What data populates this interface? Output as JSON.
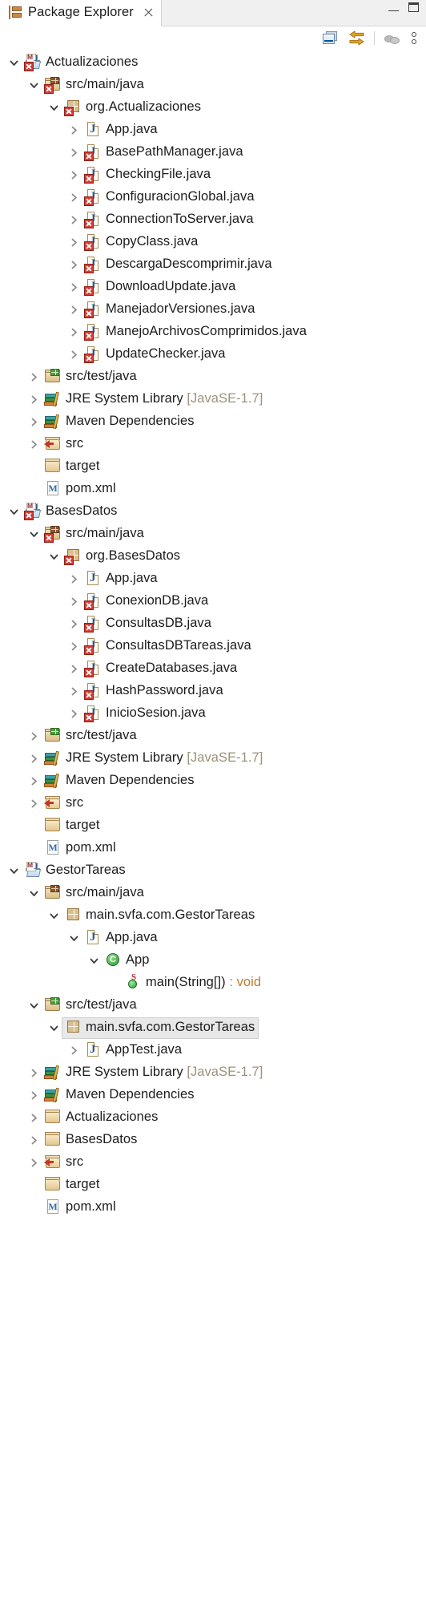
{
  "window": {
    "minimize_label": "Minimize",
    "maximize_label": "Maximize"
  },
  "tab": {
    "title": "Package Explorer",
    "icon": "package-explorer-icon",
    "close_icon": "close-icon"
  },
  "toolbar": {
    "items": [
      {
        "name": "collapse-all-button",
        "tooltip": "Collapse All"
      },
      {
        "name": "link-with-editor-button",
        "tooltip": "Link with Editor"
      },
      {
        "name": "view-menu-button",
        "tooltip": "View Menu"
      },
      {
        "name": "view-options-button",
        "tooltip": "View Menu"
      }
    ]
  },
  "colors": {
    "selection_bg": "#e8e8e8",
    "error_badge": "#d33b33",
    "dim_text": "#9b9379",
    "return_type": "#c07a2e",
    "text": "#1c1c1c"
  },
  "tree": {
    "rows": [
      {
        "indent": 0,
        "twisty": "expanded",
        "icon": "maven-java-project-icon",
        "error": true,
        "label": "Actualizaciones"
      },
      {
        "indent": 1,
        "twisty": "expanded",
        "icon": "source-folder-icon",
        "error": true,
        "label": "src/main/java"
      },
      {
        "indent": 2,
        "twisty": "expanded",
        "icon": "package-icon",
        "error": true,
        "label": "org.Actualizaciones"
      },
      {
        "indent": 3,
        "twisty": "collapsed",
        "icon": "java-file-icon",
        "error": false,
        "label": "App.java"
      },
      {
        "indent": 3,
        "twisty": "collapsed",
        "icon": "java-file-icon",
        "error": true,
        "label": "BasePathManager.java"
      },
      {
        "indent": 3,
        "twisty": "collapsed",
        "icon": "java-file-icon",
        "error": true,
        "label": "CheckingFile.java"
      },
      {
        "indent": 3,
        "twisty": "collapsed",
        "icon": "java-file-icon",
        "error": true,
        "label": "ConfiguracionGlobal.java"
      },
      {
        "indent": 3,
        "twisty": "collapsed",
        "icon": "java-file-icon",
        "error": true,
        "label": "ConnectionToServer.java"
      },
      {
        "indent": 3,
        "twisty": "collapsed",
        "icon": "java-file-icon",
        "error": true,
        "label": "CopyClass.java"
      },
      {
        "indent": 3,
        "twisty": "collapsed",
        "icon": "java-file-icon",
        "error": true,
        "label": "DescargaDescomprimir.java"
      },
      {
        "indent": 3,
        "twisty": "collapsed",
        "icon": "java-file-icon",
        "error": true,
        "label": "DownloadUpdate.java"
      },
      {
        "indent": 3,
        "twisty": "collapsed",
        "icon": "java-file-icon",
        "error": true,
        "label": "ManejadorVersiones.java"
      },
      {
        "indent": 3,
        "twisty": "collapsed",
        "icon": "java-file-icon",
        "error": true,
        "label": "ManejoArchivosComprimidos.java"
      },
      {
        "indent": 3,
        "twisty": "collapsed",
        "icon": "java-file-icon",
        "error": true,
        "label": "UpdateChecker.java"
      },
      {
        "indent": 1,
        "twisty": "collapsed",
        "icon": "test-source-folder-icon",
        "error": false,
        "label": "src/test/java"
      },
      {
        "indent": 1,
        "twisty": "collapsed",
        "icon": "library-icon",
        "error": false,
        "label": "JRE System Library ",
        "dim": "[JavaSE-1.7]"
      },
      {
        "indent": 1,
        "twisty": "collapsed",
        "icon": "library-icon",
        "error": false,
        "label": "Maven Dependencies"
      },
      {
        "indent": 1,
        "twisty": "collapsed",
        "icon": "linked-folder-icon",
        "error": false,
        "label": "src"
      },
      {
        "indent": 1,
        "twisty": "none",
        "icon": "folder-icon",
        "error": false,
        "label": "target"
      },
      {
        "indent": 1,
        "twisty": "none",
        "icon": "pom-file-icon",
        "error": false,
        "label": "pom.xml"
      },
      {
        "indent": 0,
        "twisty": "expanded",
        "icon": "maven-java-project-icon",
        "error": true,
        "label": "BasesDatos"
      },
      {
        "indent": 1,
        "twisty": "expanded",
        "icon": "source-folder-icon",
        "error": true,
        "label": "src/main/java"
      },
      {
        "indent": 2,
        "twisty": "expanded",
        "icon": "package-icon",
        "error": true,
        "label": "org.BasesDatos"
      },
      {
        "indent": 3,
        "twisty": "collapsed",
        "icon": "java-file-icon",
        "error": false,
        "label": "App.java"
      },
      {
        "indent": 3,
        "twisty": "collapsed",
        "icon": "java-file-icon",
        "error": true,
        "label": "ConexionDB.java"
      },
      {
        "indent": 3,
        "twisty": "collapsed",
        "icon": "java-file-icon",
        "error": true,
        "label": "ConsultasDB.java"
      },
      {
        "indent": 3,
        "twisty": "collapsed",
        "icon": "java-file-icon",
        "error": true,
        "label": "ConsultasDBTareas.java"
      },
      {
        "indent": 3,
        "twisty": "collapsed",
        "icon": "java-file-icon",
        "error": true,
        "label": "CreateDatabases.java"
      },
      {
        "indent": 3,
        "twisty": "collapsed",
        "icon": "java-file-icon",
        "error": true,
        "label": "HashPassword.java"
      },
      {
        "indent": 3,
        "twisty": "collapsed",
        "icon": "java-file-icon",
        "error": true,
        "label": "InicioSesion.java"
      },
      {
        "indent": 1,
        "twisty": "collapsed",
        "icon": "test-source-folder-icon",
        "error": false,
        "label": "src/test/java"
      },
      {
        "indent": 1,
        "twisty": "collapsed",
        "icon": "library-icon",
        "error": false,
        "label": "JRE System Library ",
        "dim": "[JavaSE-1.7]"
      },
      {
        "indent": 1,
        "twisty": "collapsed",
        "icon": "library-icon",
        "error": false,
        "label": "Maven Dependencies"
      },
      {
        "indent": 1,
        "twisty": "collapsed",
        "icon": "linked-folder-icon",
        "error": false,
        "label": "src"
      },
      {
        "indent": 1,
        "twisty": "none",
        "icon": "folder-icon",
        "error": false,
        "label": "target"
      },
      {
        "indent": 1,
        "twisty": "none",
        "icon": "pom-file-icon",
        "error": false,
        "label": "pom.xml"
      },
      {
        "indent": 0,
        "twisty": "expanded",
        "icon": "maven-java-project-icon",
        "error": false,
        "label": "GestorTareas"
      },
      {
        "indent": 1,
        "twisty": "expanded",
        "icon": "source-folder-icon",
        "error": false,
        "label": "src/main/java"
      },
      {
        "indent": 2,
        "twisty": "expanded",
        "icon": "package-icon",
        "error": false,
        "label": "main.svfa.com.GestorTareas"
      },
      {
        "indent": 3,
        "twisty": "expanded",
        "icon": "java-file-icon",
        "error": false,
        "label": "App.java"
      },
      {
        "indent": 4,
        "twisty": "expanded",
        "icon": "class-icon",
        "error": false,
        "label": "App"
      },
      {
        "indent": 5,
        "twisty": "none",
        "icon": "method-static-icon",
        "error": false,
        "label": "main(String[]) ",
        "ret": ": void"
      },
      {
        "indent": 1,
        "twisty": "expanded",
        "icon": "test-source-folder-icon",
        "error": false,
        "label": "src/test/java"
      },
      {
        "indent": 2,
        "twisty": "expanded",
        "icon": "package-icon",
        "error": false,
        "label": "main.svfa.com.GestorTareas",
        "selected": true
      },
      {
        "indent": 3,
        "twisty": "collapsed",
        "icon": "java-file-icon",
        "error": false,
        "label": "AppTest.java"
      },
      {
        "indent": 1,
        "twisty": "collapsed",
        "icon": "library-icon",
        "error": false,
        "label": "JRE System Library ",
        "dim": "[JavaSE-1.7]"
      },
      {
        "indent": 1,
        "twisty": "collapsed",
        "icon": "library-icon",
        "error": false,
        "label": "Maven Dependencies"
      },
      {
        "indent": 1,
        "twisty": "collapsed",
        "icon": "folder-icon",
        "error": false,
        "label": "Actualizaciones"
      },
      {
        "indent": 1,
        "twisty": "collapsed",
        "icon": "folder-icon",
        "error": false,
        "label": "BasesDatos"
      },
      {
        "indent": 1,
        "twisty": "collapsed",
        "icon": "linked-folder-icon",
        "error": false,
        "label": "src"
      },
      {
        "indent": 1,
        "twisty": "none",
        "icon": "folder-icon",
        "error": false,
        "label": "target"
      },
      {
        "indent": 1,
        "twisty": "none",
        "icon": "pom-file-icon",
        "error": false,
        "label": "pom.xml"
      }
    ]
  }
}
